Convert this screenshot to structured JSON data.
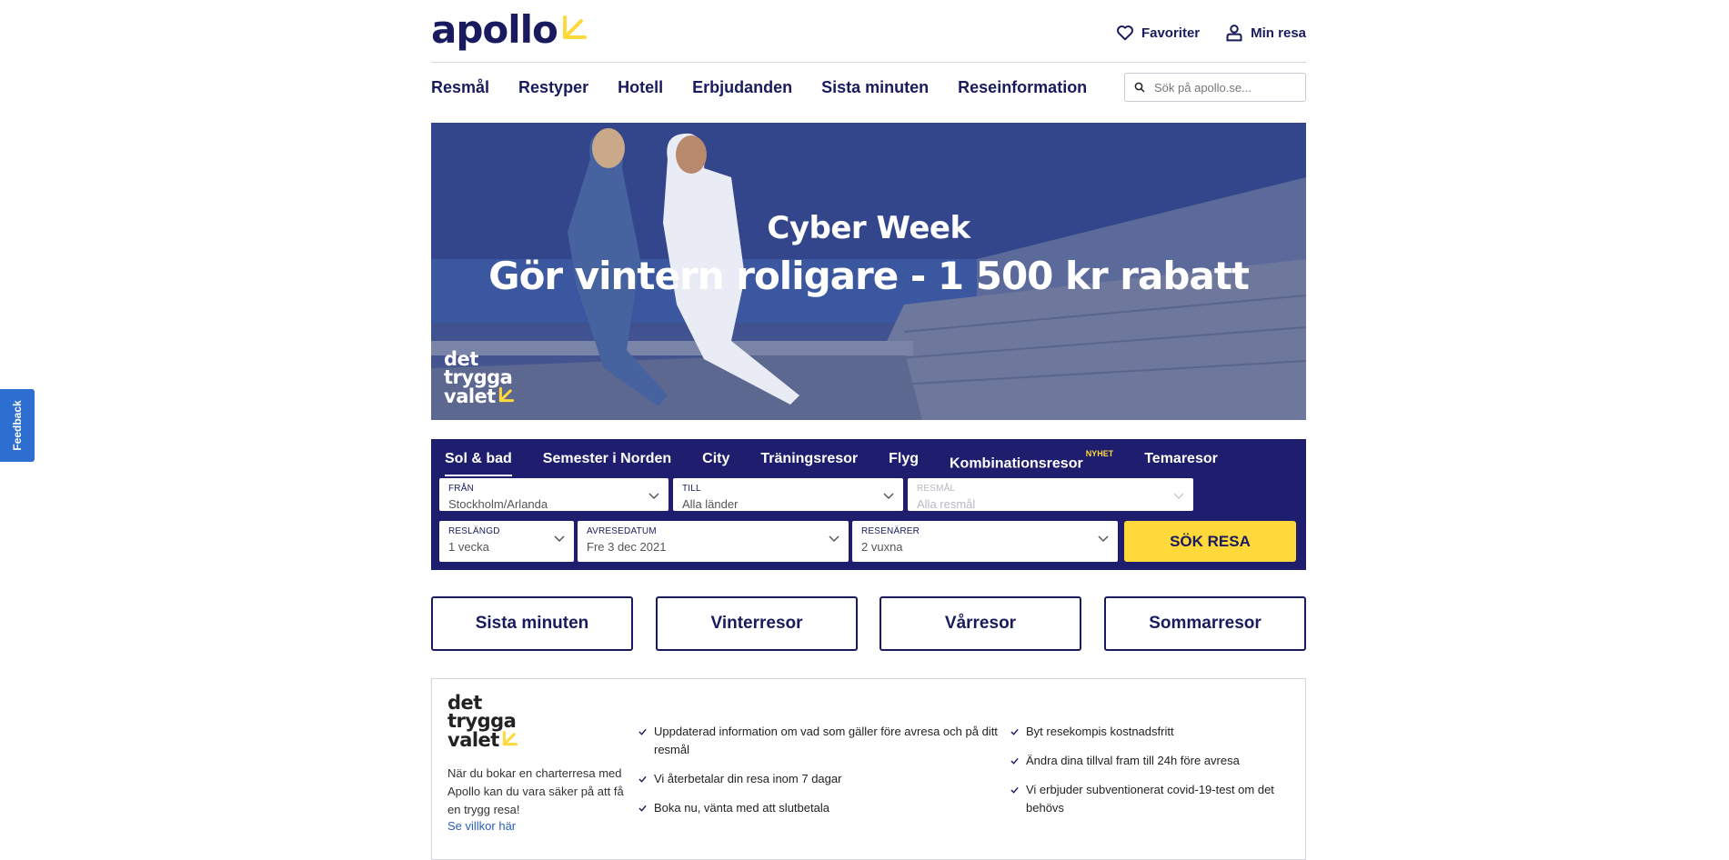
{
  "header": {
    "logo_text": "apollo",
    "favorites_label": "Favoriter",
    "my_trip_label": "Min resa"
  },
  "nav": {
    "items": [
      "Resmål",
      "Restyper",
      "Hotell",
      "Erbjudanden",
      "Sista minuten",
      "Reseinformation"
    ],
    "search_placeholder": "Sök på apollo.se..."
  },
  "hero": {
    "line1": "Cyber Week",
    "line2": "Gör vintern roligare - 1 500 kr rabatt",
    "badge": [
      "det",
      "trygga",
      "valet"
    ]
  },
  "booking": {
    "tabs": [
      {
        "label": "Sol & bad",
        "active": true
      },
      {
        "label": "Semester i Norden"
      },
      {
        "label": "City"
      },
      {
        "label": "Träningsresor"
      },
      {
        "label": "Flyg"
      },
      {
        "label": "Kombinationsresor",
        "badge": "NYHET"
      },
      {
        "label": "Temaresor"
      }
    ],
    "fields": {
      "from": {
        "label": "FRÅN",
        "value": "Stockholm/Arlanda"
      },
      "to": {
        "label": "TILL",
        "value": "Alla länder"
      },
      "destination": {
        "label": "RESMÅL",
        "value": "Alla resmål"
      },
      "duration": {
        "label": "RESLÄNGD",
        "value": "1 vecka"
      },
      "date": {
        "label": "AVRESEDATUM",
        "value": "Fre 3 dec 2021"
      },
      "travellers": {
        "label": "RESENÄRER",
        "value": "2 vuxna"
      }
    },
    "search_button": "SÖK RESA"
  },
  "quick_links": [
    "Sista minuten",
    "Vinterresor",
    "Vårresor",
    "Sommarresor"
  ],
  "info": {
    "badge": [
      "det",
      "trygga",
      "valet"
    ],
    "description": "När du bokar en charterresa med Apollo kan du vara säker på att få en trygg resa!",
    "link": "Se villkor här",
    "col1": [
      "Uppdaterad information om vad som gäller före avresa och på ditt resmål",
      "Vi återbetalar din resa inom 7 dagar",
      "Boka nu, vänta med att slutbetala"
    ],
    "col2": [
      "Byt resekompis kostnadsfritt",
      "Ändra dina tillval fram till 24h före avresa",
      "Vi erbjuder subventionerat covid-19-test om det behövs"
    ]
  },
  "feedback_label": "Feedback",
  "colors": {
    "brand_navy": "#1a1b5e",
    "brand_yellow": "#ffd83a",
    "widget_bg": "#1e1d6e",
    "feedback_blue": "#2c6fd1"
  }
}
